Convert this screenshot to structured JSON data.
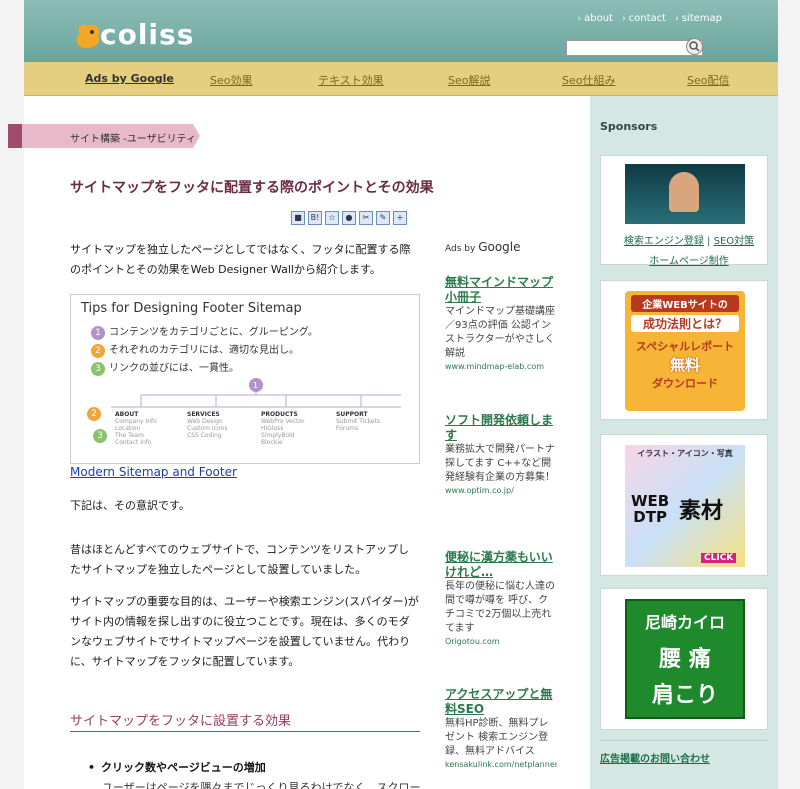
{
  "header": {
    "logo": "coliss",
    "links": [
      "about",
      "contact",
      "sitemap"
    ],
    "search": {
      "value": "",
      "placeholder": ""
    }
  },
  "nav": {
    "items": [
      "Ads by Google",
      "Seo効果",
      "テキスト効果",
      "Seo解説",
      "Seo仕組み",
      "Seo配信"
    ]
  },
  "article": {
    "category": "サイト構築 -ユーザビリティ",
    "title": "サイトマップをフッタに配置する際のポイントとその効果",
    "intro": "サイトマップを独立したページとしてではなく、フッタに配置する際のポイントとその効果をWeb Designer Wallから紹介します。",
    "figure": {
      "title": "Tips for Designing Footer Sitemap",
      "points": [
        "コンテンツをカテゴリごとに、グルーピング。",
        "それぞれのカテゴリには、適切な見出し。",
        "リンクの並びには、一貫性。"
      ],
      "columns": [
        {
          "head": "ABOUT",
          "items": [
            "Company Info",
            "Location",
            "The Team",
            "Contact Info"
          ]
        },
        {
          "head": "SERVICES",
          "items": [
            "Web Design",
            "Custom Icons",
            "CSS Coding"
          ]
        },
        {
          "head": "PRODUCTS",
          "items": [
            "WebPro Vector",
            "HiGloss",
            "SimplyBold",
            "Blockie"
          ]
        },
        {
          "head": "SUPPORT",
          "items": [
            "Submit Tickets",
            "Forums"
          ]
        }
      ]
    },
    "link": "Modern Sitemap and Footer",
    "p1": "下記は、その意訳です。",
    "p2": "昔はほとんどすべてのウェブサイトで、コンテンツをリストアップしたサイトマップを独立したページとして設置していました。",
    "p3": "サイトマップの重要な目的は、ユーザーや検索エンジン(スパイダー)がサイト内の情報を探し出すのに役立つことです。現在は、多くのモダンなウェブサイトでサイトマップページを設置していません。代わりに、サイトマップをフッタに配置しています。",
    "h2": "サイトマップをフッタに設置する効果",
    "bullet_head": "クリック数やページビューの増加",
    "bullet_text": "ユーザーはページを隅々までじっくり見るわけでなく、スクロー"
  },
  "ads": {
    "label": "Ads by",
    "brand": "Google",
    "items": [
      {
        "title": "無料マインドマップ小冊子",
        "desc": "マインドマップ基礎講座／93点の評価 公認インストラクターがやさしく解説",
        "url": "www.mindmap-elab.com"
      },
      {
        "title": "ソフト開発依頼します",
        "desc": "業務拡大で開発パートナ探してます C++など開発経験有企業の方募集！",
        "url": "www.optim.co.jp/"
      },
      {
        "title": "便秘に漢方薬もいいけれど…",
        "desc": "長年の便秘に悩む人達の間で噂が噂を 呼び、クチコミで2万個以上売れてます",
        "url": "Origotou.com"
      },
      {
        "title": "アクセスアップと無料SEO",
        "desc": "無料HP診断、無料プレゼント 検索エンジン登録、無料アドバイス",
        "url": "kensakulink.com/netplanner"
      }
    ]
  },
  "sidebar": {
    "heading": "Sponsors",
    "box1_links": [
      "検索エンジン登録",
      "SEO対策",
      "ホームページ制作"
    ],
    "banner2": {
      "line1": "企業WEBサイトの",
      "line2": "成功法則とは？",
      "line3": "スペシャルレポート",
      "line4": "無料",
      "line5": "ダウンロード"
    },
    "banner3": {
      "line1": "イラスト・アイコン・写真",
      "line2": "WEB",
      "line3": "DTP",
      "line4": "素材",
      "line5": "CLICK"
    },
    "banner4": {
      "line1": "尼崎カイロ",
      "line2": "腰 痛",
      "line3": "肩こり"
    },
    "footer_link": "広告掲載のお問い合わせ"
  },
  "colors": {
    "header": "#6aa69e",
    "nav": "#e3cf7f",
    "title": "#6b2c44",
    "sidebar": "#d4e7e2",
    "link": "#1c3fb5"
  }
}
